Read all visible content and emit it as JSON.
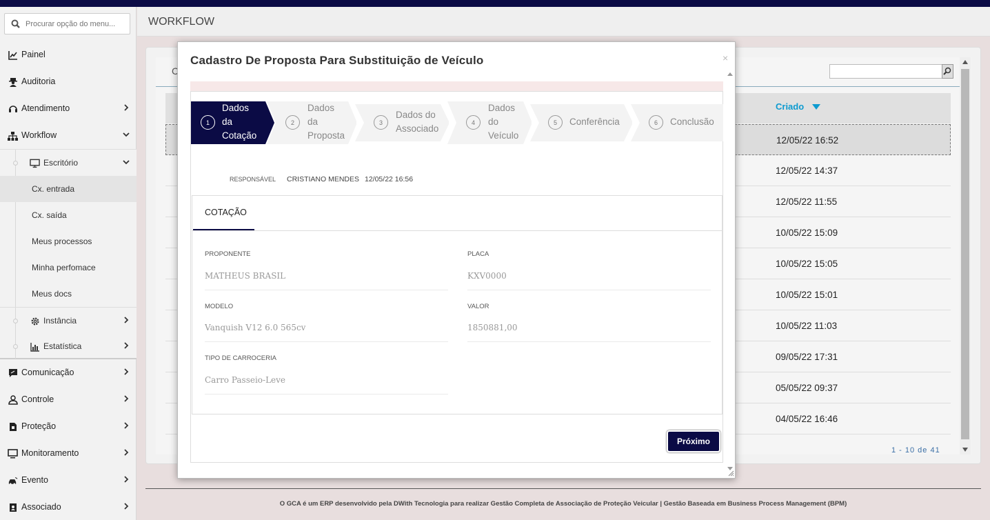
{
  "sidebar": {
    "search_placeholder": "Procurar opção do menu...",
    "items": [
      {
        "label": "Painel"
      },
      {
        "label": "Auditoria"
      },
      {
        "label": "Atendimento"
      },
      {
        "label": "Workflow"
      },
      {
        "label": "Escritório"
      },
      {
        "label": "Cx. entrada"
      },
      {
        "label": "Cx. saída"
      },
      {
        "label": "Meus processos"
      },
      {
        "label": "Minha perfomace"
      },
      {
        "label": "Meus docs"
      },
      {
        "label": "Instância"
      },
      {
        "label": "Estatística"
      },
      {
        "label": "Comunicação"
      },
      {
        "label": "Controle"
      },
      {
        "label": "Proteção"
      },
      {
        "label": "Monitoramento"
      },
      {
        "label": "Evento"
      },
      {
        "label": "Associado"
      }
    ]
  },
  "header": {
    "title": "WORKFLOW"
  },
  "grid": {
    "partial_label": "C",
    "column_created": "Criado",
    "rows": [
      "12/05/22 16:52",
      "12/05/22 14:37",
      "12/05/22 11:55",
      "10/05/22 15:09",
      "10/05/22 15:05",
      "10/05/22 15:01",
      "10/05/22 11:03",
      "09/05/22 17:31",
      "05/05/22 09:37",
      "04/05/22 16:46"
    ],
    "pager": "1 - 10 de 41"
  },
  "footer": {
    "text": "O GCA é um ERP desenvolvido pela DWith Tecnologia para realizar Gestão Completa de Associação de Proteção Veicular | Gestão Baseada em Business Process Management (BPM)"
  },
  "modal": {
    "title": "Cadastro De Proposta Para Substituição de Veículo",
    "close": "×",
    "steps": [
      {
        "num": "1",
        "lines": [
          "Dados",
          "da",
          "Cotação"
        ]
      },
      {
        "num": "2",
        "lines": [
          "Dados",
          "da",
          "Proposta"
        ]
      },
      {
        "num": "3",
        "lines": [
          "Dados do",
          "Associado"
        ]
      },
      {
        "num": "4",
        "lines": [
          "Dados",
          "do",
          "Veículo"
        ]
      },
      {
        "num": "5",
        "lines": [
          "Conferência"
        ]
      },
      {
        "num": "6",
        "lines": [
          "Conclusão"
        ]
      }
    ],
    "responsavel_label": "RESPONSÁVEL",
    "responsavel_name": "CRISTIANO MENDES",
    "responsavel_date": "12/05/22 16:56",
    "tab": "COTAÇÃO",
    "fields": {
      "proponente": {
        "label": "PROPONENTE",
        "value": "MATHEUS BRASIL"
      },
      "placa": {
        "label": "PLACA",
        "value": "KXV0000"
      },
      "modelo": {
        "label": "MODELO",
        "value": "Vanquish V12 6.0 565cv"
      },
      "valor": {
        "label": "VALOR",
        "value": "1850881,00"
      },
      "carroceria": {
        "label": "TIPO DE CARROCERIA",
        "value": "Carro Passeio-Leve"
      }
    },
    "next_label": "Próximo"
  },
  "colors": {
    "primary": "#0b0b45",
    "accent": "#0d9bd0"
  }
}
